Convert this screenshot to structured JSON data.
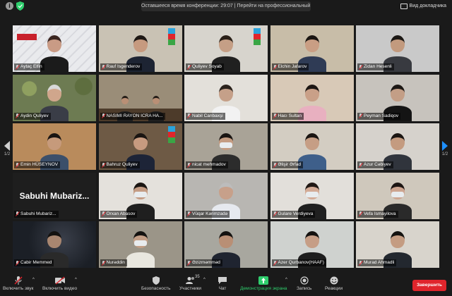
{
  "topbar": {
    "banner_text": "Оставшееся время конференции: 29:07 | Перейти на профессиональный план",
    "view_label": "Вид докладчика"
  },
  "participants": [
    {
      "name": "Aytaç Elfin",
      "scene": {
        "bg": "#e9eaed",
        "skin": "#c99b85",
        "cloth": "#1b1b1b",
        "hair": "#3a2520",
        "extra": "apa"
      }
    },
    {
      "name": "Rauf Isgenderov",
      "scene": {
        "bg": "#c9c2b4",
        "skin": "#c69a7f",
        "cloth": "#1d2433",
        "hair": "#1e1815",
        "extra": "office"
      }
    },
    {
      "name": "Quliyev Soyab",
      "scene": {
        "bg": "#d7d4cd",
        "skin": "#c59f86",
        "cloth": "#202020",
        "hair": "#2a2018",
        "extra": "office"
      }
    },
    {
      "name": "Elchin Jafarov",
      "scene": {
        "bg": "#c8bda8",
        "skin": "#c99e84",
        "cloth": "#2f3b55",
        "hair": "#1a1512",
        "extra": "room"
      }
    },
    {
      "name": "Zidan Hesenli",
      "scene": {
        "bg": "#c9c9c9",
        "skin": "#c29a7e",
        "cloth": "#383a40",
        "hair": "#1b1714",
        "extra": "room"
      }
    },
    {
      "name": "Aydin Quliyev",
      "scene": {
        "bg": "#6d7b52",
        "skin": "#d0a68c",
        "cloth": "#3a3d47",
        "hair": "#d8d8d8",
        "extra": "garden"
      }
    },
    {
      "name": "NASIMI RAYON ICRA HA...",
      "scene": {
        "bg": "#9a8d78",
        "skin": "#b98f75",
        "cloth": "#1f1f1f",
        "hair": "#221b16",
        "extra": "meeting"
      }
    },
    {
      "name": "Nabil Canbaxşi",
      "scene": {
        "bg": "#e3e0da",
        "skin": "#c5a089",
        "cloth": "#f2f2f2",
        "hair": "#2a221c",
        "extra": "room"
      }
    },
    {
      "name": "Hacı Sultan",
      "scene": {
        "bg": "#d8c9b7",
        "skin": "#c9a088",
        "cloth": "#e8b0c0",
        "hair": "#1c1613",
        "extra": "room"
      }
    },
    {
      "name": "Peyman Sadiqov",
      "scene": {
        "bg": "#c7c3bd",
        "skin": "#c39e86",
        "cloth": "#141414",
        "hair": "#1c1714",
        "extra": "room"
      }
    },
    {
      "name": "Emin HÜSEYNOV",
      "scene": {
        "bg": "#b98b5c",
        "skin": "#c69a7b",
        "cloth": "#3b4f6a",
        "hair": "#1a1512",
        "extra": "room"
      }
    },
    {
      "name": "Bahruz Quliyev",
      "scene": {
        "bg": "#6e5a45",
        "skin": "#c79b80",
        "cloth": "#1d2437",
        "hair": "#1a1512",
        "extra": "office"
      }
    },
    {
      "name": "nicat mehmadov",
      "scene": {
        "bg": "#a9a397",
        "skin": "#c49c82",
        "cloth": "#2c2c2c",
        "hair": "#1a1512",
        "extra": "mask"
      }
    },
    {
      "name": "Əlişir Ərfad",
      "scene": {
        "bg": "#d3cdc2",
        "skin": "#c69e85",
        "cloth": "#3e5f8a",
        "hair": "#1a1512",
        "extra": "room"
      }
    },
    {
      "name": "Azur Cəbiyev",
      "scene": {
        "bg": "#d6d2cc",
        "skin": "#c49b80",
        "cloth": "#30343c",
        "hair": "#1a1512",
        "extra": "room"
      }
    },
    {
      "name": "Sabuhi Mubariz...",
      "scene": {
        "bg": "#1e1e1e",
        "skin": "",
        "cloth": "",
        "hair": "",
        "extra": "nameonly"
      }
    },
    {
      "name": "Orxan Abasov",
      "scene": {
        "bg": "#e4e1dc",
        "skin": "#c49c84",
        "cloth": "#1f1f1f",
        "hair": "#1a1512",
        "extra": "mask"
      }
    },
    {
      "name": "Vüqar Kərimzadə",
      "scene": {
        "bg": "#b8b6b2",
        "skin": "#c7a08a",
        "cloth": "#e6e9ef",
        "hair": "#bcbcbc",
        "extra": "room"
      }
    },
    {
      "name": "Gulare Verdiyeva",
      "scene": {
        "bg": "#e2dfda",
        "skin": "#d3ab96",
        "cloth": "#202020",
        "hair": "#201814",
        "extra": "mask"
      }
    },
    {
      "name": "Vefa Ismayilova",
      "scene": {
        "bg": "#cfc8bc",
        "skin": "#cda590",
        "cloth": "#2a2a2a",
        "hair": "#1c1512",
        "extra": "mask"
      }
    },
    {
      "name": "Cabir Memmed",
      "scene": {
        "bg": "#1b1f26",
        "skin": "#a88670",
        "cloth": "#2a2a2a",
        "hair": "#141210",
        "extra": "dark"
      }
    },
    {
      "name": "Nurəddin",
      "scene": {
        "bg": "#9b9588",
        "skin": "#c39e86",
        "cloth": "#e9e7df",
        "hair": "#141210",
        "extra": "mask"
      }
    },
    {
      "name": "Əzizməmməd",
      "scene": {
        "bg": "#a8a79f",
        "skin": "#b98f75",
        "cloth": "#1f2430",
        "hair": "#141210",
        "extra": "room"
      }
    },
    {
      "name": "Azer Qurbanov(HAAF)",
      "scene": {
        "bg": "#cfd2cf",
        "skin": "#c69e86",
        "cloth": "#1e1e1e",
        "hair": "#141210",
        "extra": "room"
      }
    },
    {
      "name": "Murad Ahmadli",
      "scene": {
        "bg": "#d8d4cc",
        "skin": "#c49c82",
        "cloth": "#23282f",
        "hair": "#141210",
        "extra": "room"
      }
    }
  ],
  "pager": {
    "left_label": "1/2",
    "right_label": "1/2"
  },
  "toolbar": {
    "mute_label": "Включить звук",
    "video_label": "Включить видео",
    "security_label": "Безопасность",
    "participants_label": "Участники",
    "participants_count": "35",
    "chat_label": "Чат",
    "share_label": "Демонстрация экрана",
    "record_label": "Запись",
    "reactions_label": "Реакции",
    "leave_label": "Завершить",
    "share_color": "#2fce6d",
    "leave_color": "#e0252c"
  }
}
